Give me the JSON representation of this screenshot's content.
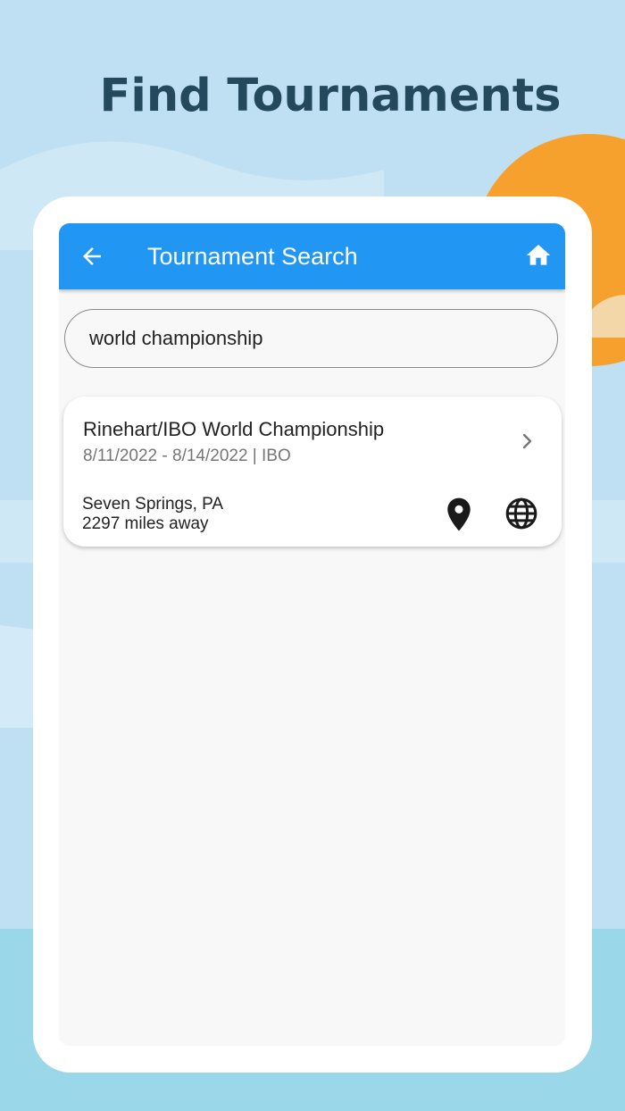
{
  "headline": "Find Tournaments",
  "appbar": {
    "title": "Tournament Search",
    "back_icon": "arrow-back-icon",
    "home_icon": "home-icon"
  },
  "search": {
    "value": "world championship"
  },
  "results": [
    {
      "title": "Rinehart/IBO World Championship",
      "subtitle": "8/11/2022 - 8/14/2022 | IBO",
      "location": "Seven Springs, PA",
      "distance": "2297 miles away",
      "icons": [
        "chevron-right-icon",
        "map-pin-icon",
        "globe-icon"
      ]
    }
  ],
  "colors": {
    "appbar": "#2196f3",
    "headline": "#24485c",
    "background": "#bfe0f2",
    "sun": "#f6a12d"
  }
}
